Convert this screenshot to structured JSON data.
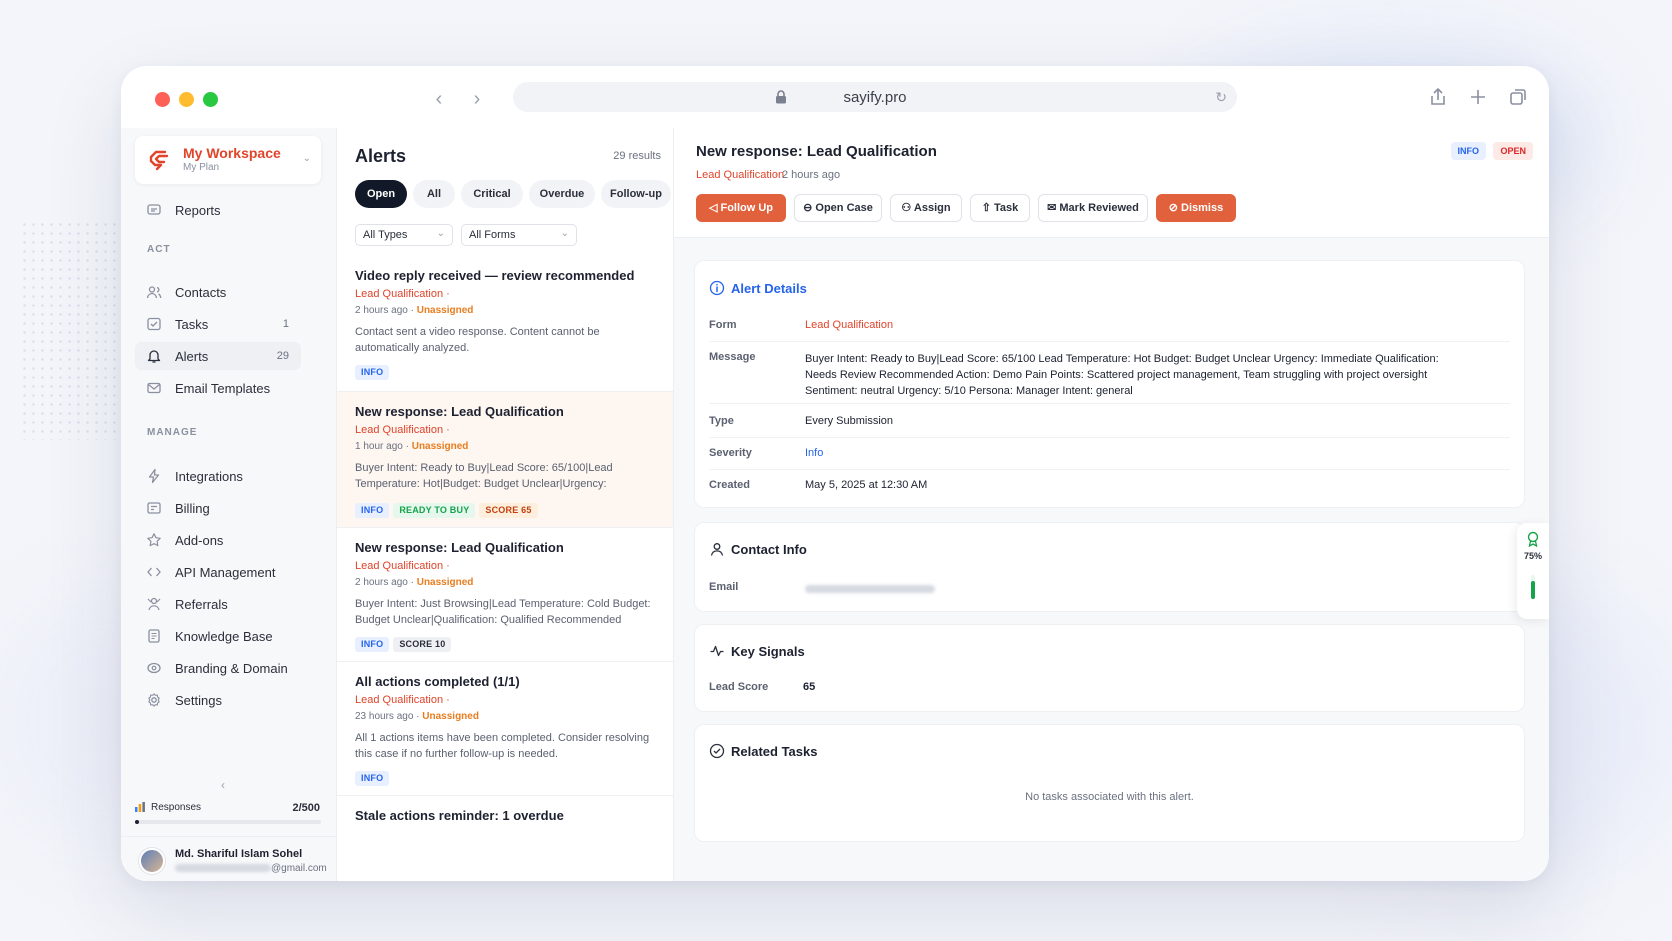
{
  "browser": {
    "url": "sayify.pro"
  },
  "workspace": {
    "name": "My Workspace",
    "plan": "My Plan"
  },
  "sidebar": {
    "reports": "Reports",
    "act_heading": "ACT",
    "act_items": [
      {
        "label": "Contacts",
        "count": ""
      },
      {
        "label": "Tasks",
        "count": "1"
      },
      {
        "label": "Alerts",
        "count": "29"
      },
      {
        "label": "Email Templates",
        "count": ""
      }
    ],
    "manage_heading": "MANAGE",
    "manage_items": [
      {
        "label": "Integrations"
      },
      {
        "label": "Billing"
      },
      {
        "label": "Add-ons"
      },
      {
        "label": "API Management"
      },
      {
        "label": "Referrals"
      },
      {
        "label": "Knowledge Base"
      },
      {
        "label": "Branding & Domain"
      },
      {
        "label": "Settings"
      }
    ],
    "responses": {
      "label": "Responses",
      "value": "2/500",
      "progress": 0.004
    },
    "user": {
      "name": "Md. Shariful Islam Sohel",
      "email_suffix": "@gmail.com"
    }
  },
  "alerts_list": {
    "title": "Alerts",
    "count": "29 results",
    "filters": [
      "Open",
      "All",
      "Critical",
      "Overdue",
      "Follow-up"
    ],
    "active_filter": "Open",
    "type_select": "All Types",
    "form_select": "All Forms",
    "items": [
      {
        "title": "Video reply received — review recommended",
        "form": "Lead Qualification",
        "time": "2 hours ago",
        "assignee": "Unassigned",
        "body": "Contact sent a video response. Content cannot be automatically analyzed.",
        "tags": [
          "INFO"
        ]
      },
      {
        "title": "New response: Lead Qualification",
        "form": "Lead Qualification",
        "time": "1 hour ago",
        "assignee": "Unassigned",
        "body": "Buyer Intent: Ready to Buy|Lead Score: 65/100|Lead Temperature: Hot|Budget: Budget Unclear|Urgency: Immediate...",
        "tags": [
          "INFO",
          "READY TO BUY",
          "SCORE 65"
        ]
      },
      {
        "title": "New response: Lead Qualification",
        "form": "Lead Qualification",
        "time": "2 hours ago",
        "assignee": "Unassigned",
        "body": "Buyer Intent: Just Browsing|Lead Temperature: Cold Budget: Budget Unclear|Qualification: Qualified Recommended Action...",
        "tags": [
          "INFO",
          "SCORE 10"
        ]
      },
      {
        "title": "All actions completed (1/1)",
        "form": "Lead Qualification",
        "time": "23 hours ago",
        "assignee": "Unassigned",
        "body": "All 1 actions items have been completed. Consider resolving this case if no further follow-up is needed.",
        "tags": [
          "INFO"
        ]
      },
      {
        "title": "Stale actions reminder: 1 overdue",
        "form": "",
        "time": "",
        "assignee": "",
        "body": "",
        "tags": []
      }
    ]
  },
  "detail": {
    "title": "New response: Lead Qualification",
    "form": "Lead Qualification",
    "time": "2 hours ago",
    "badges": [
      "INFO",
      "OPEN"
    ],
    "actions": [
      "Follow Up",
      "Open Case",
      "Assign",
      "Task",
      "Mark Reviewed",
      "Dismiss"
    ],
    "alert_details": {
      "title": "Alert Details",
      "rows": [
        {
          "label": "Form",
          "value": "Lead Qualification"
        },
        {
          "label": "Message",
          "value": "Buyer Intent: Ready to Buy|Lead Score: 65/100 Lead Temperature: Hot Budget: Budget Unclear Urgency: Immediate Qualification: Needs Review Recommended Action: Demo Pain Points: Scattered project management, Team struggling with project oversight Sentiment: neutral Urgency: 5/10 Persona: Manager Intent: general"
        },
        {
          "label": "Type",
          "value": "Every Submission"
        },
        {
          "label": "Severity",
          "value": "Info"
        },
        {
          "label": "Created",
          "value": "May 5, 2025 at 12:30 AM"
        }
      ]
    },
    "contact_info": {
      "title": "Contact Info",
      "email_label": "Email"
    },
    "key_signals": {
      "title": "Key Signals",
      "label": "Lead Score",
      "value": "65"
    },
    "related_tasks": {
      "title": "Related Tasks",
      "empty": "No tasks associated with this alert."
    },
    "widget": {
      "percent": "75%"
    }
  },
  "colors": {
    "accent": "#e0442a",
    "button": "#e0613c",
    "info": "#2563eb"
  }
}
